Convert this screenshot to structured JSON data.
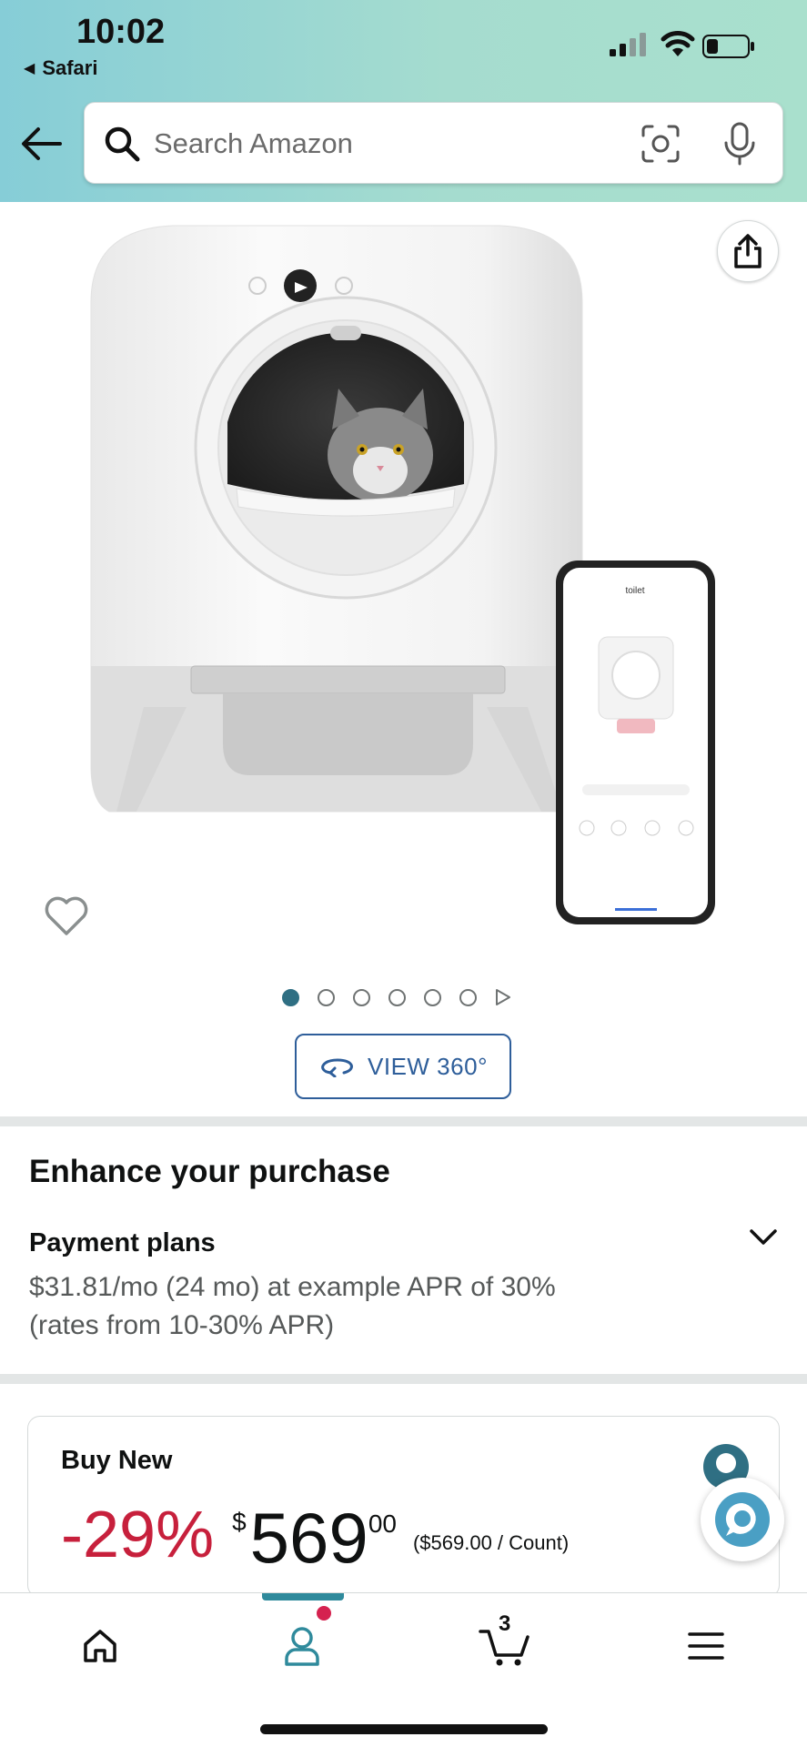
{
  "status_bar": {
    "time": "10:02",
    "back_app": "Safari"
  },
  "search": {
    "placeholder": "Search Amazon"
  },
  "gallery": {
    "image_count": 6,
    "active_index": 0,
    "has_video": true,
    "view360_label": "VIEW 360°"
  },
  "enhance": {
    "title": "Enhance your purchase",
    "payment_title": "Payment plans",
    "payment_line1": "$31.81/mo (24 mo) at example APR of 30%",
    "payment_line2": "(rates from 10-30% APR)"
  },
  "buy_box": {
    "title": "Buy New",
    "discount": "-29%",
    "currency_symbol": "$",
    "price_whole": "569",
    "price_cents": "00",
    "unit_price": "($569.00 / Count)"
  },
  "bottom_nav": {
    "cart_count": "3",
    "active_tab": "account"
  },
  "colors": {
    "header_gradient_start": "#86cdd7",
    "header_gradient_end": "#a9e0cd",
    "accent": "#2f6f83",
    "discount_red": "#c7203c",
    "link_blue": "#2e5e9a"
  }
}
